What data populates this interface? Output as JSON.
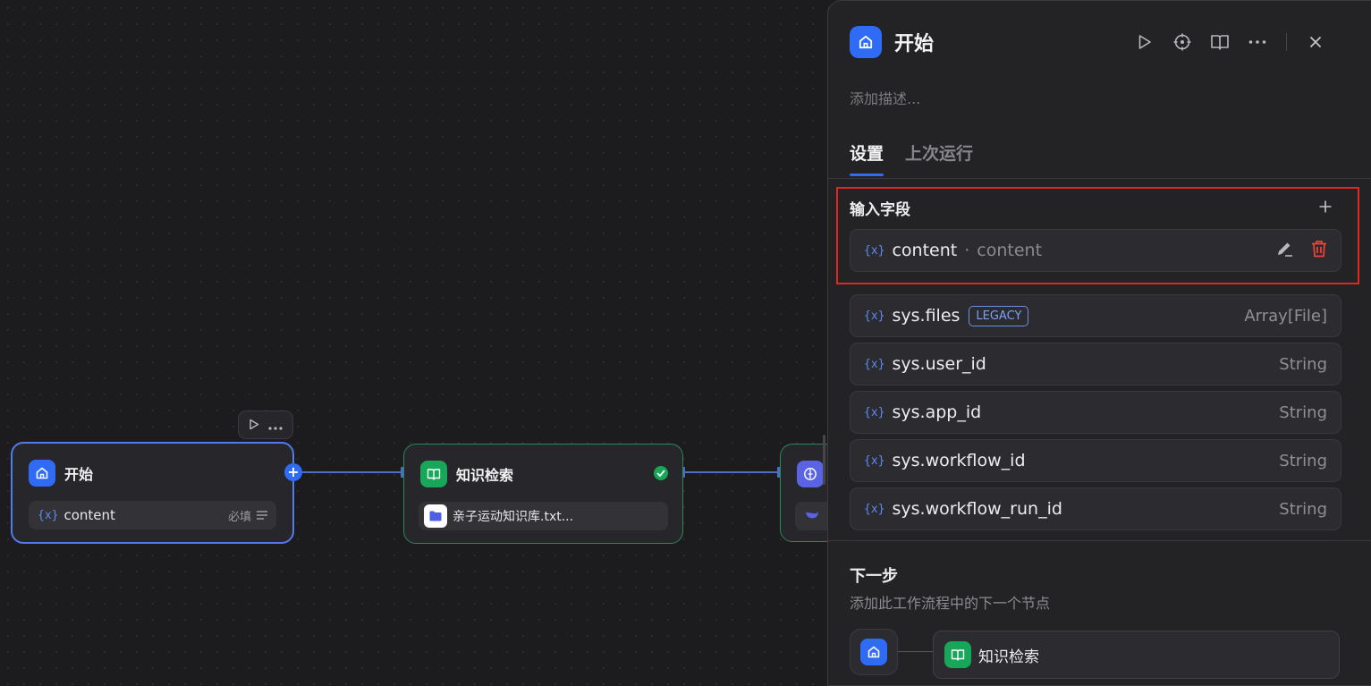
{
  "canvas": {
    "start_node": {
      "title": "开始",
      "field": {
        "var_mark": "{x}",
        "name": "content",
        "required_label": "必填"
      }
    },
    "kb_node": {
      "title": "知识检索",
      "file": "亲子运动知识库.txt..."
    }
  },
  "panel": {
    "title": "开始",
    "description_placeholder": "添加描述...",
    "tabs": [
      {
        "label": "设置"
      },
      {
        "label": "上次运行"
      }
    ],
    "input_section": {
      "title": "输入字段",
      "fields": [
        {
          "var_mark": "{x}",
          "name": "content",
          "separator": "·",
          "label": "content"
        }
      ]
    },
    "system_vars": [
      {
        "var_mark": "{x}",
        "name": "sys.files",
        "badge": "LEGACY",
        "type": "Array[File]"
      },
      {
        "var_mark": "{x}",
        "name": "sys.user_id",
        "type": "String"
      },
      {
        "var_mark": "{x}",
        "name": "sys.app_id",
        "type": "String"
      },
      {
        "var_mark": "{x}",
        "name": "sys.workflow_id",
        "type": "String"
      },
      {
        "var_mark": "{x}",
        "name": "sys.workflow_run_id",
        "type": "String"
      }
    ],
    "next_step": {
      "title": "下一步",
      "subtitle": "添加此工作流程中的下一个节点",
      "node_label": "知识检索"
    }
  },
  "colors": {
    "accent": "#2f6bf4",
    "start_icon": "#2f6bf4",
    "kb_icon": "#18a659",
    "highlight_box": "#e0281e",
    "delete_icon": "#f04438"
  },
  "icons": [
    "home-icon",
    "book-icon",
    "folder-icon",
    "play-icon",
    "more-icon",
    "locate-icon",
    "book-open-icon",
    "close-icon",
    "plus-icon",
    "edit-icon",
    "trash-icon",
    "check-icon",
    "menu-lines-icon"
  ]
}
